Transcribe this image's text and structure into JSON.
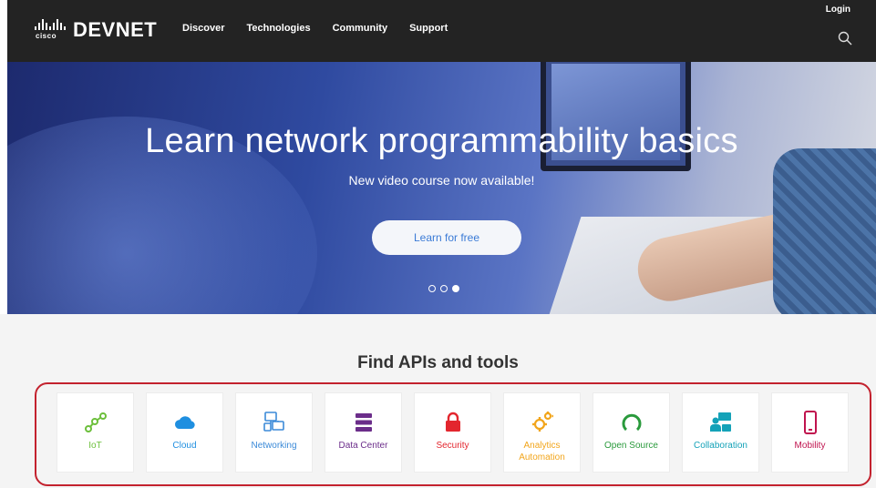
{
  "nav": {
    "logo_small": "cisco",
    "brand": "DEVNET",
    "links": [
      "Discover",
      "Technologies",
      "Community",
      "Support"
    ],
    "login": "Login"
  },
  "hero": {
    "title": "Learn network programmability basics",
    "subtitle": "New video course now available!",
    "cta": "Learn for free",
    "carousel": {
      "total": 3,
      "active": 3
    }
  },
  "tools": {
    "title": "Find APIs and tools",
    "items": [
      {
        "label": "IoT",
        "icon": "iot-icon",
        "color": "#6cbf3b"
      },
      {
        "label": "Cloud",
        "icon": "cloud-icon",
        "color": "#1f8fe0"
      },
      {
        "label": "Networking",
        "icon": "networking-icon",
        "color": "#3b8ad8"
      },
      {
        "label": "Data Center",
        "icon": "data-center-icon",
        "color": "#6b2d8a"
      },
      {
        "label": "Security",
        "icon": "lock-icon",
        "color": "#e3262e"
      },
      {
        "label": "Analytics Automation",
        "icon": "gears-icon",
        "color": "#f2a51b"
      },
      {
        "label": "Open Source",
        "icon": "open-source-icon",
        "color": "#2a9a3c"
      },
      {
        "label": "Collaboration",
        "icon": "collaboration-icon",
        "color": "#14a2b8"
      },
      {
        "label": "Mobility",
        "icon": "mobile-icon",
        "color": "#c0134e"
      }
    ]
  }
}
